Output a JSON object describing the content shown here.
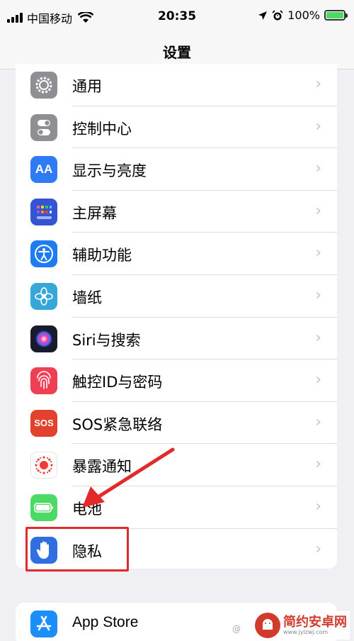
{
  "status_bar": {
    "carrier": "中国移动",
    "time": "20:35",
    "battery": "100%"
  },
  "nav": {
    "title": "设置"
  },
  "settings": [
    {
      "label": "通用",
      "icon": "gear-icon",
      "color": "#8e8e93"
    },
    {
      "label": "控制中心",
      "icon": "control-center-icon",
      "color": "#8e8e93"
    },
    {
      "label": "显示与亮度",
      "icon": "display-brightness-icon",
      "color": "#2f7bf5",
      "glyph": "AA"
    },
    {
      "label": "主屏幕",
      "icon": "home-screen-icon",
      "color": "#3454d1"
    },
    {
      "label": "辅助功能",
      "icon": "accessibility-icon",
      "color": "#1e7cf0"
    },
    {
      "label": "墙纸",
      "icon": "wallpaper-icon",
      "color": "#36a8d8"
    },
    {
      "label": "Siri与搜索",
      "icon": "siri-icon",
      "color": "#1a1a2e"
    },
    {
      "label": "触控ID与密码",
      "icon": "fingerprint-icon",
      "color": "#ef3f55"
    },
    {
      "label": "SOS紧急联络",
      "icon": "sos-icon",
      "color": "#e2412e",
      "glyph": "SOS"
    },
    {
      "label": "暴露通知",
      "icon": "exposure-notification-icon",
      "color": "#ffffff"
    },
    {
      "label": "电池",
      "icon": "battery-icon",
      "color": "#4cd964"
    },
    {
      "label": "隐私",
      "icon": "hand-privacy-icon",
      "color": "#2f6fe0"
    }
  ],
  "settings_group_2": [
    {
      "label": "App Store",
      "icon": "app-store-icon",
      "color": "#1c8ef9"
    }
  ],
  "watermark": {
    "text": "简约安卓网",
    "url": "www.jylzwj.com"
  }
}
